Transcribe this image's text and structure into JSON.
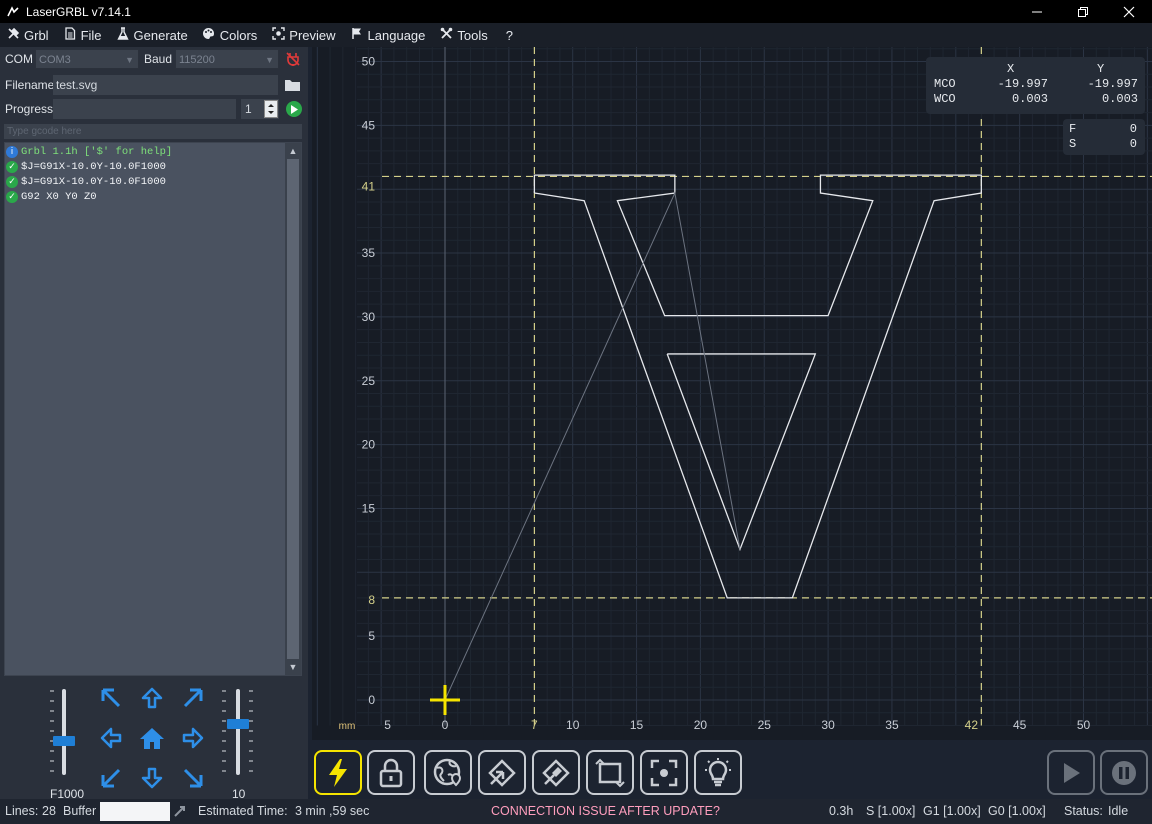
{
  "window": {
    "title": "LaserGRBL v7.14.1",
    "minimize": "—",
    "maximize": "❐",
    "close": "✕"
  },
  "menu": [
    {
      "label": "Grbl",
      "icon": "tools-icon"
    },
    {
      "label": "File",
      "icon": "file-icon"
    },
    {
      "label": "Generate",
      "icon": "flask-icon"
    },
    {
      "label": "Colors",
      "icon": "palette-icon"
    },
    {
      "label": "Preview",
      "icon": "preview-icon"
    },
    {
      "label": "Language",
      "icon": "flag-icon"
    },
    {
      "label": "Tools",
      "icon": "wrench-icon"
    },
    {
      "label": "?",
      "icon": ""
    }
  ],
  "connection": {
    "com_label": "COM",
    "com_value": "COM3",
    "baud_label": "Baud",
    "baud_value": "115200"
  },
  "file": {
    "filename_label": "Filename",
    "filename_value": "test.svg",
    "progress_label": "Progress",
    "progress_fraction": 0,
    "copies_value": "1"
  },
  "gcode_input": {
    "placeholder": "Type gcode here"
  },
  "console": [
    {
      "type": "info",
      "text": "Grbl 1.1h ['$' for help]"
    },
    {
      "type": "ok",
      "text": "$J=G91X-10.0Y-10.0F1000"
    },
    {
      "type": "ok",
      "text": "$J=G91X-10.0Y-10.0F1000"
    },
    {
      "type": "ok",
      "text": "G92 X0 Y0 Z0"
    }
  ],
  "jog": {
    "speed_label": "F1000",
    "speed_level": 0.38,
    "step_label": "10",
    "step_level": 0.6
  },
  "coords": {
    "x_header": "X",
    "y_header": "Y",
    "mco_label": "MCO",
    "mco_x": "-19.997",
    "mco_y": "-19.997",
    "wco_label": "WCO",
    "wco_x": "0.003",
    "wco_y": "0.003",
    "f_label": "F",
    "f_value": "0",
    "s_label": "S",
    "s_value": "0"
  },
  "plot": {
    "unit": "mm",
    "x_ticks": [
      5,
      0,
      10,
      15,
      20,
      25,
      30,
      35,
      45,
      50
    ],
    "y_ticks": [
      50,
      45,
      35,
      30,
      25,
      20,
      15,
      5,
      0
    ],
    "bound_x_min": "7",
    "bound_x_max": "42",
    "bound_y_min": "8",
    "bound_y_max": "41",
    "colors": {
      "background": "#171c25",
      "grid": "#283140",
      "bounds": "#d4d08a",
      "cursor": "#f5e400",
      "path": "#e6e8ec"
    }
  },
  "toolbar": {
    "buttons": [
      {
        "name": "connect-button",
        "icon": "lightning-icon",
        "active": true
      },
      {
        "name": "unlock-button",
        "icon": "unlock-icon"
      },
      {
        "name": "reset-button",
        "icon": "globe-icon"
      },
      {
        "name": "homing-button",
        "icon": "home-tool-icon"
      },
      {
        "name": "center-button",
        "icon": "marker-icon"
      },
      {
        "name": "frame-button",
        "icon": "frame-icon"
      },
      {
        "name": "focus-button",
        "icon": "focus-icon"
      },
      {
        "name": "laser-button",
        "icon": "bulb-icon"
      }
    ],
    "run": "run-icon",
    "abort": "pause-icon"
  },
  "status": {
    "lines_label": "Lines:",
    "lines_value": "28",
    "buffer_label": "Buffer",
    "estimated_label": "Estimated Time:",
    "estimated_value": "3 min ,59 sec",
    "warning": "CONNECTION ISSUE AFTER UPDATE?",
    "time": "0.3h",
    "speed": "S [1.00x]",
    "g1": "G1 [1.00x]",
    "g0": "G0 [1.00x]",
    "status_label": "Status:",
    "status_value": "Idle"
  }
}
